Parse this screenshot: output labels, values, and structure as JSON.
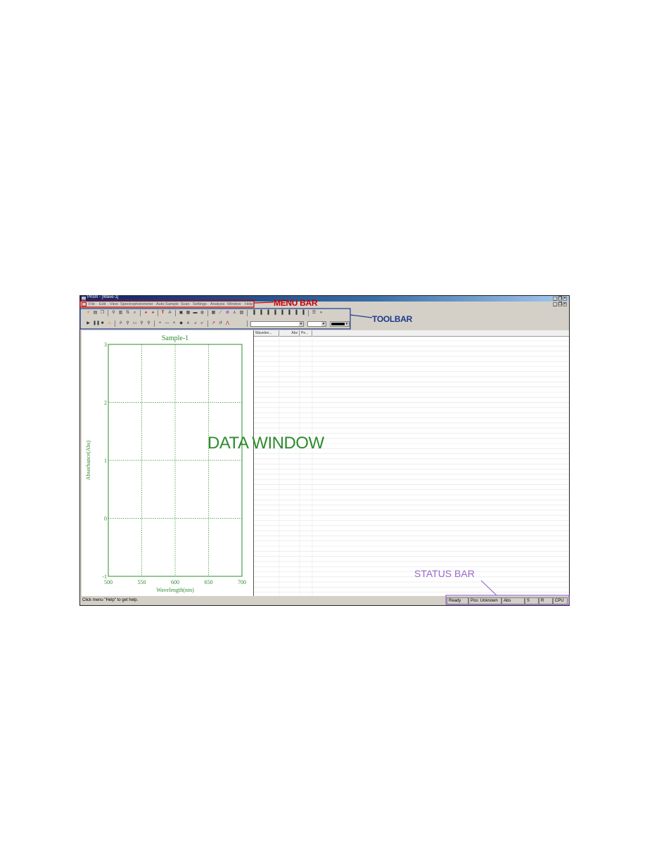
{
  "window": {
    "title": "Prism - [Wave-1]",
    "controls": [
      "_",
      "❐",
      "×"
    ]
  },
  "menu": {
    "items": [
      "File",
      "Edit",
      "View",
      "Spectrophotometer",
      "Auto-Sample",
      "Scan",
      "Settings",
      "Analysis",
      "Window",
      "Help"
    ]
  },
  "toolbar": {
    "row1_icons": [
      "new-icon",
      "print-icon",
      "copy-icon",
      "zoom-icon",
      "data-icon",
      "sort-icon",
      "find-icon",
      "mark-icon",
      "mark2-icon",
      "text-icon",
      "font-icon",
      "save-icon",
      "open-icon",
      "folder-icon",
      "disk-icon",
      "table-icon",
      "chart-icon",
      "stop-icon",
      "peak-icon",
      "export-icon",
      "bar1-icon",
      "bar2-icon",
      "bar3-icon",
      "bar4-icon",
      "bar5-icon",
      "bar6-icon",
      "bar7-icon",
      "bar8-icon",
      "list-icon",
      "more-icon"
    ],
    "row2_icons": [
      "play-icon",
      "pause-icon",
      "stop-square-icon",
      "warning-icon",
      "grid-icon",
      "zoom-in-icon",
      "zoom-box-icon",
      "zoom-plus-icon",
      "zoom-minus-icon",
      "crosshair-icon",
      "hline-icon",
      "cross-icon",
      "dot-icon",
      "peak-up-icon",
      "peak-down-icon",
      "peak-pick-icon",
      "rotate-icon",
      "label-icon"
    ],
    "color_value": "#000000"
  },
  "graph": {
    "title": "Sample-1",
    "xlabel": "Wavelength(nm)",
    "ylabel": "Absorbance(Abs)"
  },
  "chart_data": {
    "type": "line",
    "title": "Sample-1",
    "xlabel": "Wavelength(nm)",
    "ylabel": "Absorbance(Abs)",
    "xlim": [
      500,
      700
    ],
    "ylim": [
      -1,
      3
    ],
    "x_ticks": [
      "500",
      "550",
      "600",
      "650",
      "700"
    ],
    "y_ticks": [
      "3",
      "2",
      "1",
      "0",
      "-1"
    ],
    "grid": true,
    "series": []
  },
  "table": {
    "columns": [
      "Wavelen...",
      "Abs",
      "Pe..."
    ]
  },
  "status": {
    "help_text": "Click menu \"Help\" to get help.",
    "panels": [
      "Ready",
      "Pos: Unknown",
      "Abs",
      "S",
      "R",
      "CPU"
    ]
  },
  "annotations": {
    "menu_bar": "MENU BAR",
    "toolbar": "TOOLBAR",
    "data_window": "DATA WINDOW",
    "status_bar": "STATUS BAR"
  },
  "colors": {
    "menu_annotation": "#cc0000",
    "toolbar_annotation": "#1e3a8a",
    "data_annotation": "#2e8b2e",
    "status_annotation": "#9966cc",
    "plot": "#2e8b2e"
  }
}
